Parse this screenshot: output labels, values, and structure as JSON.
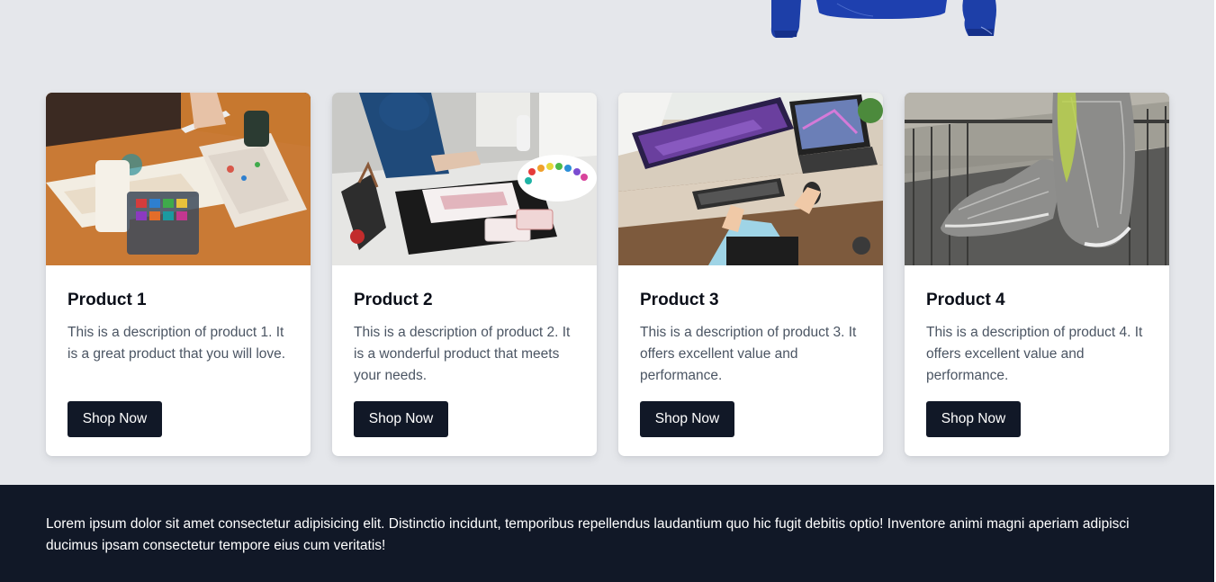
{
  "products": [
    {
      "title": "Product 1",
      "description": "This is a description of product 1. It is a great product that you will love.",
      "button_label": "Shop Now"
    },
    {
      "title": "Product 2",
      "description": "This is a description of product 2. It is a wonderful product that meets your needs.",
      "button_label": "Shop Now"
    },
    {
      "title": "Product 3",
      "description": "This is a description of product 3. It offers excellent value and performance.",
      "button_label": "Shop Now"
    },
    {
      "title": "Product 4",
      "description": "This is a description of product 4. It offers excellent value and performance.",
      "button_label": "Shop Now"
    }
  ],
  "footer": {
    "text": "Lorem ipsum dolor sit amet consectetur adipisicing elit. Distinctio incidunt, temporibus repellendus laudantium quo hic fugit debitis optio! Inventore animi magni aperiam adipisci ducimus ipsam consectetur tempore eius cum veritatis!"
  },
  "colors": {
    "page_background": "#e5e7eb",
    "dark": "#111827",
    "card_background": "#ffffff",
    "description_text": "#4b5563",
    "hoodie_blue": "#1e40af"
  }
}
